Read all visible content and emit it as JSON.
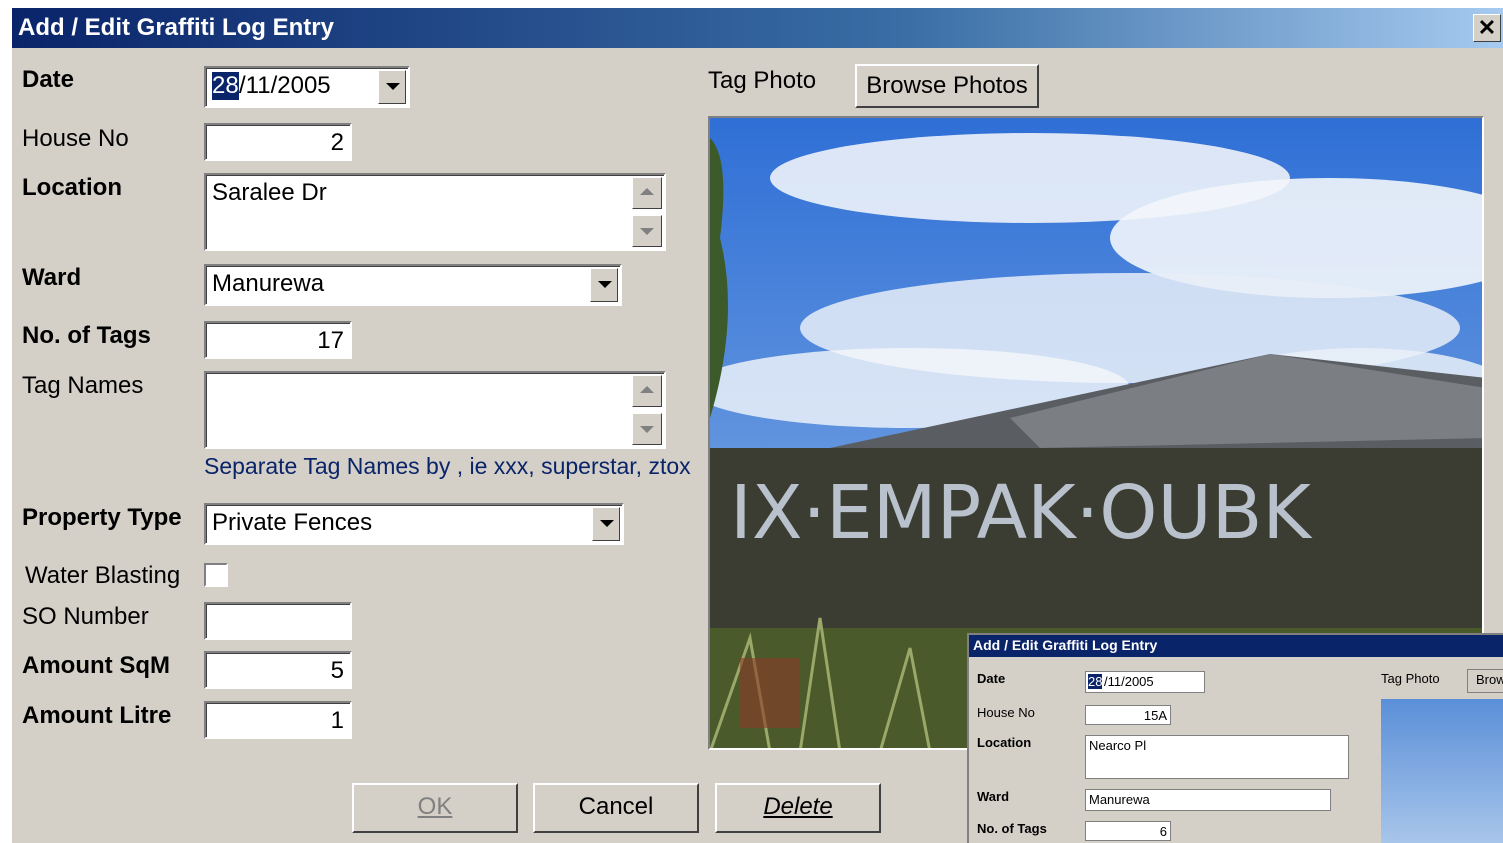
{
  "window": {
    "title": "Add / Edit Graffiti Log Entry",
    "close_label": "✕"
  },
  "form": {
    "date_label": "Date",
    "date_value_day": "28",
    "date_value_rest": "/11/2005",
    "house_no_label": "House No",
    "house_no_value": "2",
    "location_label": "Location",
    "location_value": "Saralee Dr",
    "ward_label": "Ward",
    "ward_value": "Manurewa",
    "tags_label": "No. of Tags",
    "tags_value": "17",
    "tag_names_label": "Tag Names",
    "tag_names_value": "",
    "tag_names_hint": "Separate Tag Names by , ie xxx, superstar, ztox",
    "property_type_label": "Property Type",
    "property_type_value": "Private Fences",
    "water_blasting_label": "Water Blasting",
    "water_blasting_checked": false,
    "so_number_label": "SO Number",
    "so_number_value": "",
    "amount_sqm_label": "Amount SqM",
    "amount_sqm_value": "5",
    "amount_litre_label": "Amount Litre",
    "amount_litre_value": "1"
  },
  "photo": {
    "label": "Tag Photo",
    "browse_label": "Browse Photos",
    "graffiti_text": "IX·EMPAK·OUBK"
  },
  "buttons": {
    "ok": "OK",
    "cancel": "Cancel",
    "delete": "Delete"
  },
  "inset": {
    "title": "Add / Edit Graffiti Log Entry",
    "date_label": "Date",
    "date_day": "28",
    "date_rest": "/11/2005",
    "house_no_label": "House No",
    "house_no_value": "15A",
    "location_label": "Location",
    "location_value": "Nearco Pl",
    "ward_label": "Ward",
    "ward_value": "Manurewa",
    "tags_label": "No. of Tags",
    "tags_value": "6",
    "photo_label": "Tag Photo",
    "browse_label": "Brow"
  },
  "colors": {
    "titlebar": "#0a246a",
    "hint": "#0a246a",
    "face": "#d4d0c8"
  }
}
